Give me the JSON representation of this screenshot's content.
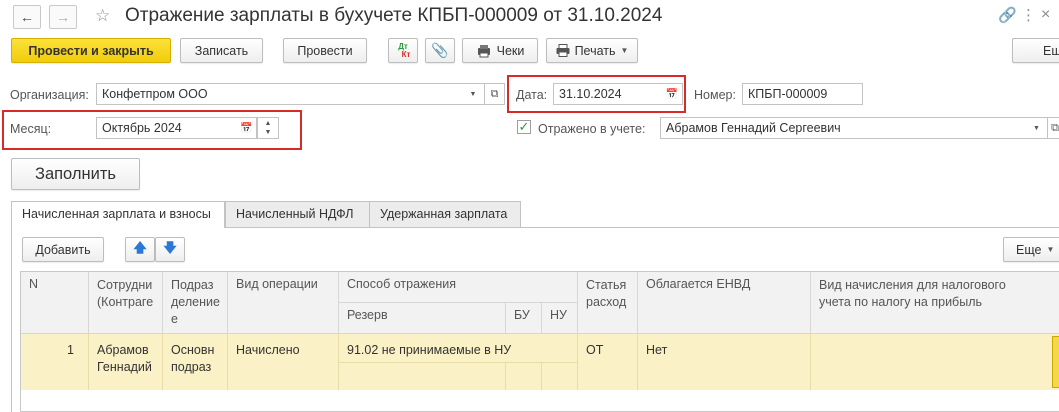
{
  "window": {
    "title": "Отражение зарплаты в бухучете КПБП-000009 от 31.10.2024"
  },
  "icons": {
    "back": "arrow-left-icon",
    "forward": "arrow-right-icon",
    "favorite": "star-icon",
    "link": "link-icon",
    "menu": "more-icon",
    "close": "close-icon"
  },
  "toolbar": {
    "post_close": "Провести и закрыть",
    "save": "Записать",
    "post": "Провести",
    "dt_kt_top": "Дт",
    "dt_kt_bottom": "Кт",
    "receipts": "Чеки",
    "print": "Печать",
    "more": "Еще"
  },
  "form": {
    "org_label": "Организация:",
    "org_value": "Конфетпром ООО",
    "date_label": "Дата:",
    "date_value": "31.10.2024",
    "number_label": "Номер:",
    "number_value": "КПБП-000009",
    "month_label": "Месяц:",
    "month_value": "Октябрь 2024",
    "reflected_label": "Отражено в учете:",
    "reflected_checked": true,
    "responsible_value": "Абрамов Геннадий Сергеевич",
    "fill_button": "Заполнить"
  },
  "tabs": [
    {
      "label": "Начисленная зарплата и взносы",
      "active": true
    },
    {
      "label": "Начисленный НДФЛ",
      "active": false
    },
    {
      "label": "Удержанная зарплата",
      "active": false
    }
  ],
  "table_toolbar": {
    "add": "Добавить",
    "more": "Еще"
  },
  "table": {
    "headers": {
      "n": "N",
      "employee_line1": "Сотрудни",
      "employee_line2": "(Контраге",
      "dept_line1": "Подраз",
      "dept_line2": "деление",
      "dept_line3": "е",
      "operation": "Вид операции",
      "method": "Способ отражения",
      "reserve": "Резерв",
      "bu": "БУ",
      "nu": "НУ",
      "expense_line1": "Статья",
      "expense_line2": "расход",
      "envd": "Облагается ЕНВД",
      "accrual_type_line1": "Вид начисления для налогового",
      "accrual_type_line2": "учета по налогу на прибыль"
    },
    "rows": [
      {
        "n": "1",
        "employee_line1": "Абрамов",
        "employee_line2": "Геннадий",
        "dept_line1": "Основн",
        "dept_line2": "подраз",
        "operation": "Начислено",
        "method": "91.02 не принимаемые в НУ",
        "expense": "ОТ",
        "envd": "Нет",
        "accrual_type": ""
      }
    ]
  },
  "colors": {
    "primary_button": "#f2cc0a",
    "highlight": "#d92a2a",
    "row_selected": "#fbf1c6",
    "arrow_blue": "#2b78d6",
    "check_green": "#2e9b3a"
  }
}
